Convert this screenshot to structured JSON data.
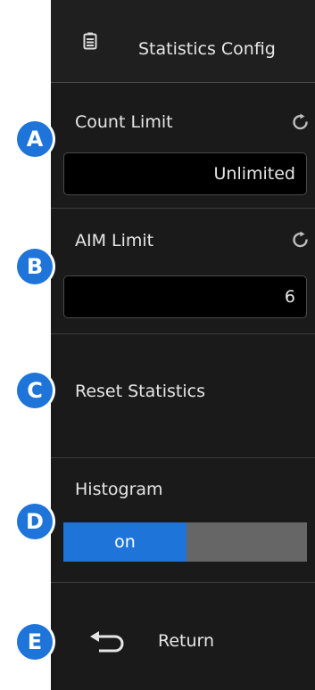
{
  "header": {
    "title": "Statistics Config",
    "icon": "clipboard-icon"
  },
  "count_limit": {
    "label": "Count Limit",
    "value": "Unlimited",
    "icon": "reset-icon"
  },
  "aim_limit": {
    "label": "AIM Limit",
    "value": "6",
    "icon": "reset-icon"
  },
  "reset": {
    "label": "Reset Statistics"
  },
  "histogram": {
    "label": "Histogram",
    "on_label": "on",
    "state": "on"
  },
  "return": {
    "label": "Return",
    "icon": "return-arrow-icon"
  },
  "callouts": [
    "A",
    "B",
    "C",
    "D",
    "E"
  ],
  "colors": {
    "accent": "#1e74d8",
    "panel": "#1a1a1a",
    "field": "#000000",
    "toggle_off": "#666666"
  }
}
